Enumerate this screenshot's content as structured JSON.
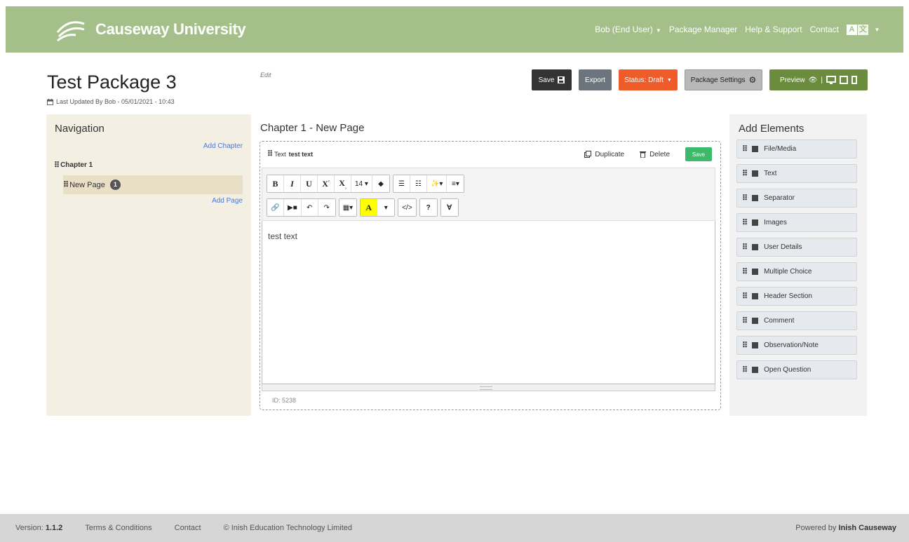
{
  "brand": {
    "name": "Causeway University"
  },
  "topnav": {
    "user": "Bob (End User)",
    "package_manager": "Package Manager",
    "help": "Help & Support",
    "contact": "Contact",
    "lang_a": "A",
    "lang_b": "文"
  },
  "page": {
    "title": "Test Package 3",
    "updated": "Last Updated By Bob - 05/01/2021 - 10:43",
    "edit": "Edit"
  },
  "actions": {
    "save": "Save",
    "export": "Export",
    "status": "Status: Draft",
    "settings": "Package Settings",
    "preview": "Preview"
  },
  "navigation": {
    "title": "Navigation",
    "add_chapter": "Add Chapter",
    "chapter": "Chapter 1",
    "page": "New Page",
    "page_badge": "1",
    "add_page": "Add Page"
  },
  "editor": {
    "chapter_title": "Chapter 1 - New Page",
    "element_type": "Text",
    "element_name": "test text",
    "duplicate": "Duplicate",
    "delete": "Delete",
    "save": "Save",
    "font_size": "14",
    "content": "test text",
    "id": "ID: 5238"
  },
  "add_elements": {
    "title": "Add Elements",
    "items": [
      "File/Media",
      "Text",
      "Separator",
      "Images",
      "User Details",
      "Multiple Choice",
      "Header Section",
      "Comment",
      "Observation/Note",
      "Open Question"
    ]
  },
  "footer": {
    "version_label": "Version:",
    "version": "1.1.2",
    "terms": "Terms & Conditions",
    "contact": "Contact",
    "copyright": "© Inish Education Technology Limited",
    "powered_label": "Powered by",
    "powered_name": "Inish Causeway"
  },
  "colors": {
    "header": "#a4bf8a",
    "status": "#f05b2a",
    "preview": "#6a8c3c",
    "save_green": "#3db96a"
  }
}
